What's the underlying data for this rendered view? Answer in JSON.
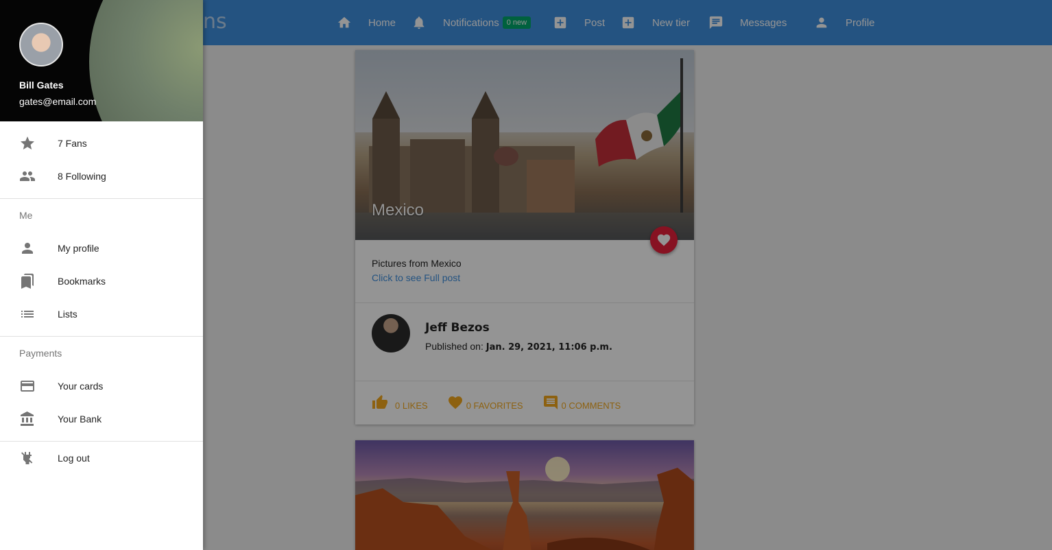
{
  "app": {
    "brand_fragment": "ns"
  },
  "nav": {
    "items": [
      {
        "label": "Home",
        "icon": "home-icon"
      },
      {
        "label": "Notifications",
        "icon": "bell-icon",
        "badge": "0 new"
      },
      {
        "label": "Post",
        "icon": "plus-box-icon"
      },
      {
        "label": "New tier",
        "icon": "plus-box-icon"
      },
      {
        "label": "Messages",
        "icon": "message-icon"
      },
      {
        "label": "Profile",
        "icon": "person-icon"
      }
    ]
  },
  "drawer": {
    "user": {
      "name": "Bill Gates",
      "email": "gates@email.com"
    },
    "stats": [
      {
        "label": "7 Fans",
        "icon": "star-icon"
      },
      {
        "label": "8 Following",
        "icon": "people-icon"
      }
    ],
    "sections": [
      {
        "title": "Me",
        "items": [
          {
            "label": "My profile",
            "icon": "person-icon"
          },
          {
            "label": "Bookmarks",
            "icon": "bookmarks-icon"
          },
          {
            "label": "Lists",
            "icon": "list-icon"
          }
        ]
      },
      {
        "title": "Payments",
        "items": [
          {
            "label": "Your cards",
            "icon": "credit-card-icon"
          },
          {
            "label": "Your Bank",
            "icon": "bank-icon"
          }
        ]
      }
    ],
    "logout": {
      "label": "Log out",
      "icon": "power-off-icon"
    }
  },
  "feed": {
    "posts": [
      {
        "title": "Mexico",
        "description": "Pictures from Mexico",
        "link": "Click to see Full post",
        "author": "Jeff Bezos",
        "published_label": "Published on:",
        "published_date": "Jan. 29, 2021, 11:06 p.m.",
        "likes": "0 LIKES",
        "favorites": "0 FAVORITES",
        "comments": "0 COMMENTS"
      }
    ]
  },
  "colors": {
    "primary": "#3f8fde",
    "accent": "#f3a81c",
    "favorite": "#e8203b",
    "badge": "#00a86b"
  }
}
